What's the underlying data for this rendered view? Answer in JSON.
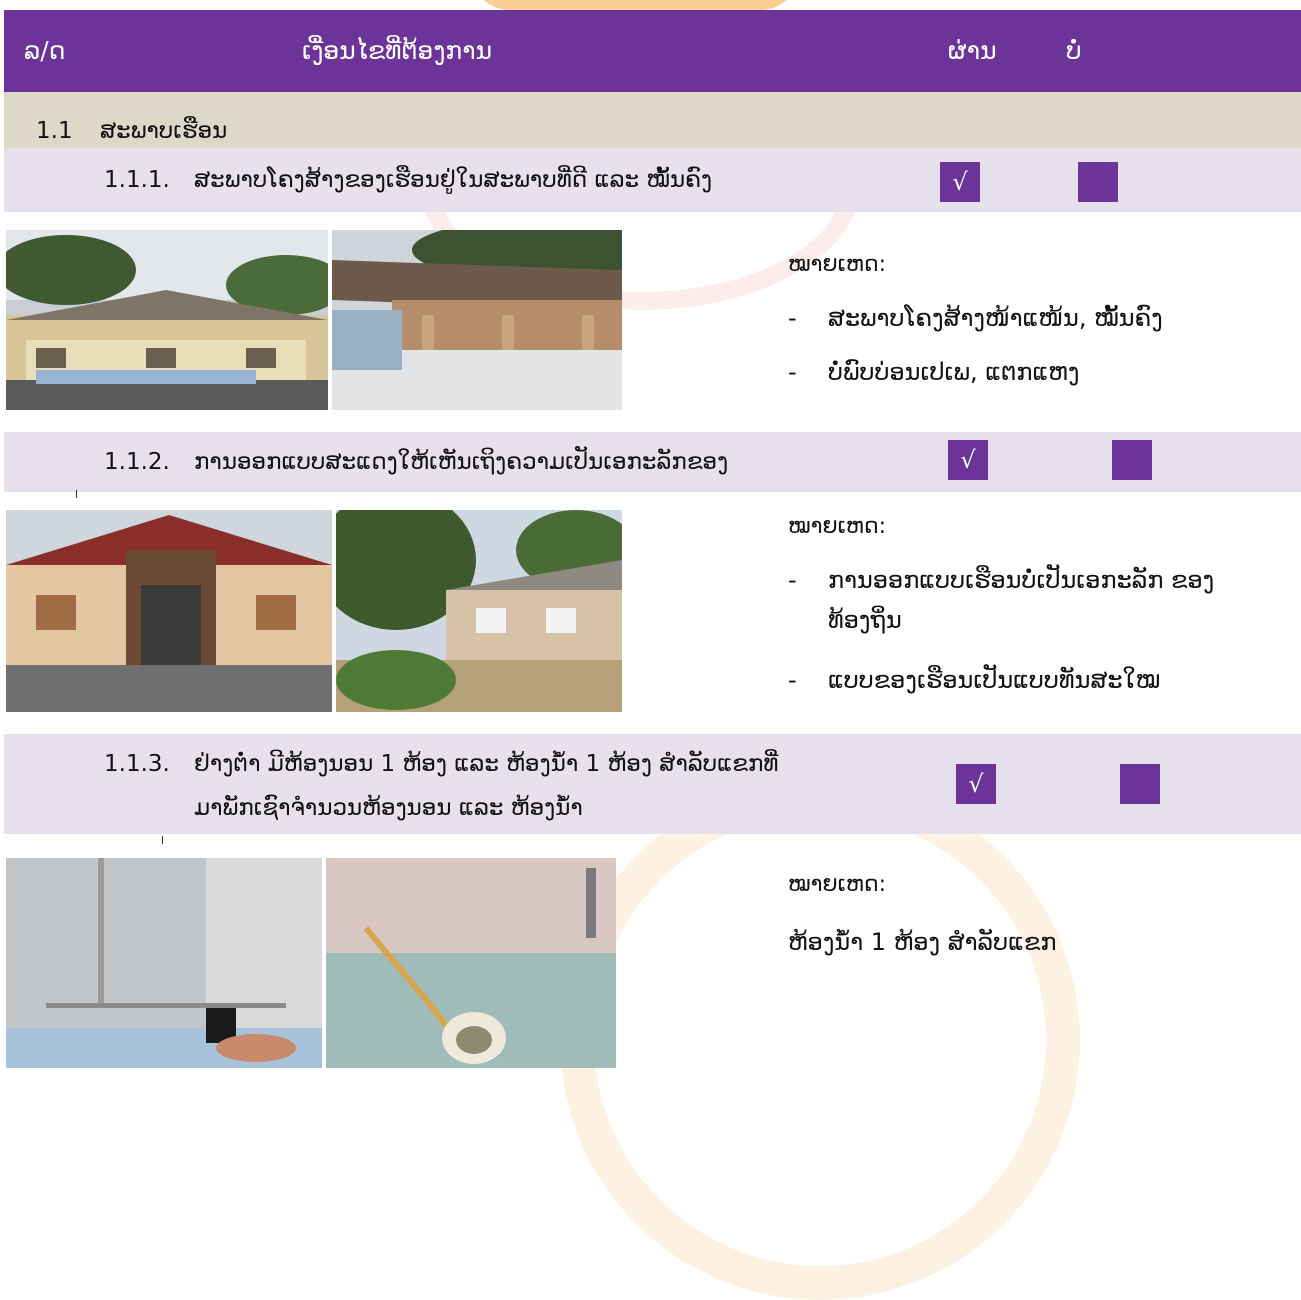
{
  "header": {
    "col_no": "ລ/ດ",
    "col_criteria": "ເງື່ອນໄຂທີ່ຕ້ອງການ",
    "col_pass": "ຜ່ານ",
    "col_fail": "ບໍ່"
  },
  "section": {
    "number": "1.1",
    "title": "ສະພາບເຮືອນ"
  },
  "items": [
    {
      "number": "1.1.1.",
      "text": "ສະພາບໂຄງສ້າງຂອງເຮືອນຢູ່ໃນສະພາບທີ່ດີ ແລະ ໝັ້ນຄົງ",
      "pass_mark": "√",
      "note_title": "ໝາຍເຫດ:",
      "notes": [
        "ສະພາບໂຄງສ້າງໜ້າແໜ້ນ, ໝັ້ນຄົງ",
        "ບໍ່ພົບບ່ອນເປເພ, ແຕກແຫງ"
      ]
    },
    {
      "number": "1.1.2.",
      "text": "ການອອກແບບສະແດງໃຫ້ເຫັນເຖິງຄວາມເປັນເອກະລັກຂອງ",
      "pass_mark": "√",
      "note_title": "ໝາຍເຫດ:",
      "notes": [
        "ການອອກແບບເຮືອນບໍ່ເປັນເອກະລັກ ຂອງທ້ອງຖິ່ນ",
        "ແບບຂອງເຮືອນເປັນແບບທັນສະໃໝ"
      ]
    },
    {
      "number": "1.1.3.",
      "text_line1": "ຢ່າງຕ່ຳ ມີຫ້ອງນອນ 1 ຫ້ອງ ແລະ ຫ້ອງນ້ຳ 1 ຫ້ອງ ສຳລັບແຂກທີ່",
      "text_line2": "ມາພັກເຊົາຈຳນວນຫ້ອງນອນ ແລະ ຫ້ອງນ້ຳ",
      "pass_mark": "√",
      "note_title": "ໝາຍເຫດ:",
      "note_text": "ຫ້ອງນ້ຳ 1 ຫ້ອງ ສຳລັບແຂກ"
    }
  ],
  "dash": "-",
  "colors": {
    "accent": "#6c3398",
    "section_bg": "#ded8c8",
    "item_bg": "#e7e1ee"
  }
}
